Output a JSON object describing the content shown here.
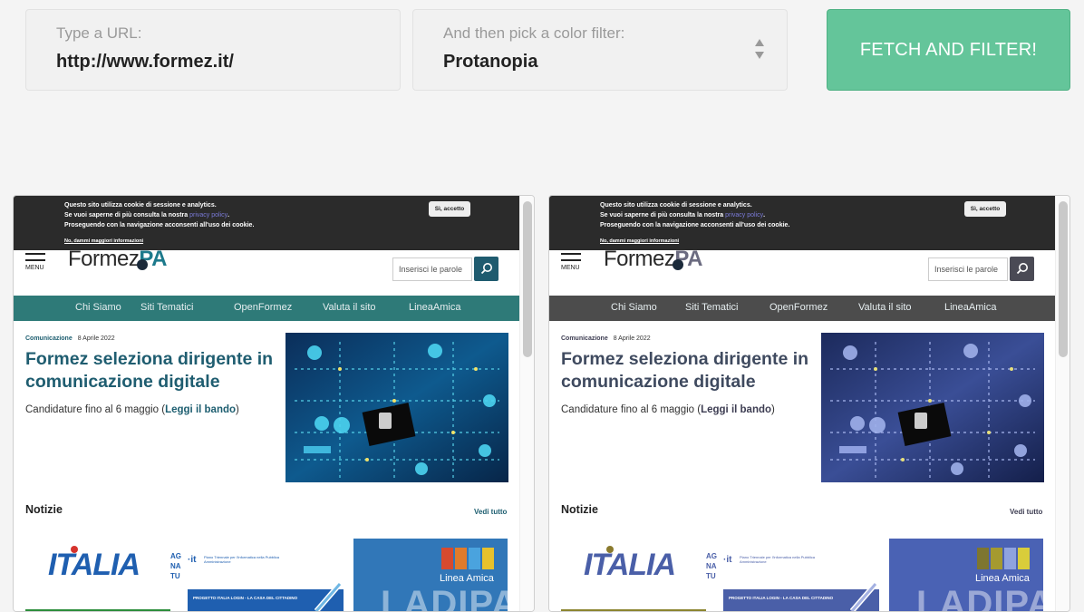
{
  "toolbar": {
    "url_label": "Type a URL:",
    "url_value": "http://www.formez.it/",
    "filter_label": "And then pick a color filter:",
    "filter_value": "Protanopia",
    "fetch_label": "FETCH AND FILTER!"
  },
  "site": {
    "cookie_line1": "Questo sito utilizza cookie di sessione e analytics.",
    "cookie_line2_prefix": "Se vuoi saperne di più consulta la nostra ",
    "cookie_privacy_link": "privacy policy",
    "cookie_line2_suffix": ".",
    "cookie_line3": "Proseguendo con la navigazione acconsenti all'uso dei cookie.",
    "cookie_more": "No, dammi maggiori informazioni",
    "cookie_accept": "Sì, accetto",
    "menu_label": "MENU",
    "logo_text": "Formez",
    "logo_pa": "PA",
    "search_placeholder": "Inserisci le parole",
    "nav": [
      "Chi Siamo",
      "Siti Tematici",
      "OpenFormez",
      "Valuta il sito",
      "LineaAmica"
    ],
    "category": "Comunicazione",
    "date": "8 Aprile 2022",
    "headline": "Formez seleziona dirigente in comunicazione digitale",
    "sub_prefix": "Candidature fino al 6 maggio (",
    "sub_link": "Leggi il bando",
    "sub_suffix": ")",
    "notizie": "Notizie",
    "vedi_tutto": "Vedi tutto",
    "thumb1_text": "ITALIA",
    "thumb1_side": "AG NA TU",
    "thumb2_text": "Piano Triennale per l'informatica nella Pubblica Amministrazione",
    "thumb2_caption": "PROGETTO ITALIA LOGIN - LA CASA DEL CITTADINO",
    "thumb3_label": "Linea Amica",
    "thumb3_big": "LADIPATT"
  },
  "colors": {
    "nav_original": "#2e7a78",
    "nav_filtered": "#4c4c4c",
    "fetch_button": "#64c59a"
  }
}
